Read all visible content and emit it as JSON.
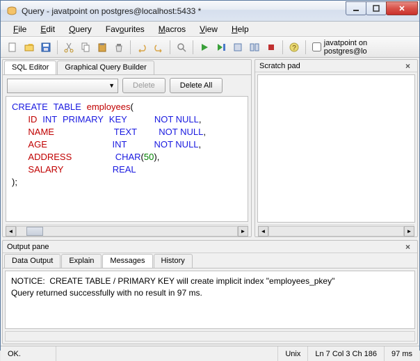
{
  "window": {
    "title": "Query - javatpoint on postgres@localhost:5433 *"
  },
  "menu": {
    "file": "File",
    "edit": "Edit",
    "query": "Query",
    "favourites": "Favourites",
    "macros": "Macros",
    "view": "View",
    "help": "Help"
  },
  "toolbar": {
    "db_label": "javatpoint on postgres@lo"
  },
  "editor": {
    "tabs": {
      "sql": "SQL Editor",
      "gqb": "Graphical Query Builder"
    },
    "delete_btn": "Delete",
    "delete_all_btn": "Delete All",
    "sql_tokens": {
      "create": "CREATE",
      "table": "TABLE",
      "ident_employees": "employees",
      "id": "ID",
      "int": "INT",
      "primary": "PRIMARY",
      "key": "KEY",
      "notnull": "NOT NULL",
      "name": "NAME",
      "text": "TEXT",
      "age": "AGE",
      "address": "ADDRESS",
      "char": "CHAR",
      "fifty": "50",
      "salary": "SALARY",
      "real": "REAL",
      "lp": "(",
      "rp": ")",
      "comma": ",",
      "semi": ";",
      "rparen_comma": ")"
    }
  },
  "scratch": {
    "title": "Scratch pad"
  },
  "output": {
    "title": "Output pane",
    "tabs": {
      "data": "Data Output",
      "explain": "Explain",
      "messages": "Messages",
      "history": "History"
    },
    "line1": "NOTICE:  CREATE TABLE / PRIMARY KEY will create implicit index \"employees_pkey\"",
    "line2": "Query returned successfully with no result in 97 ms."
  },
  "status": {
    "ok": "OK.",
    "enc": "Unix",
    "pos": "Ln 7 Col 3 Ch 186",
    "time": "97 ms"
  }
}
